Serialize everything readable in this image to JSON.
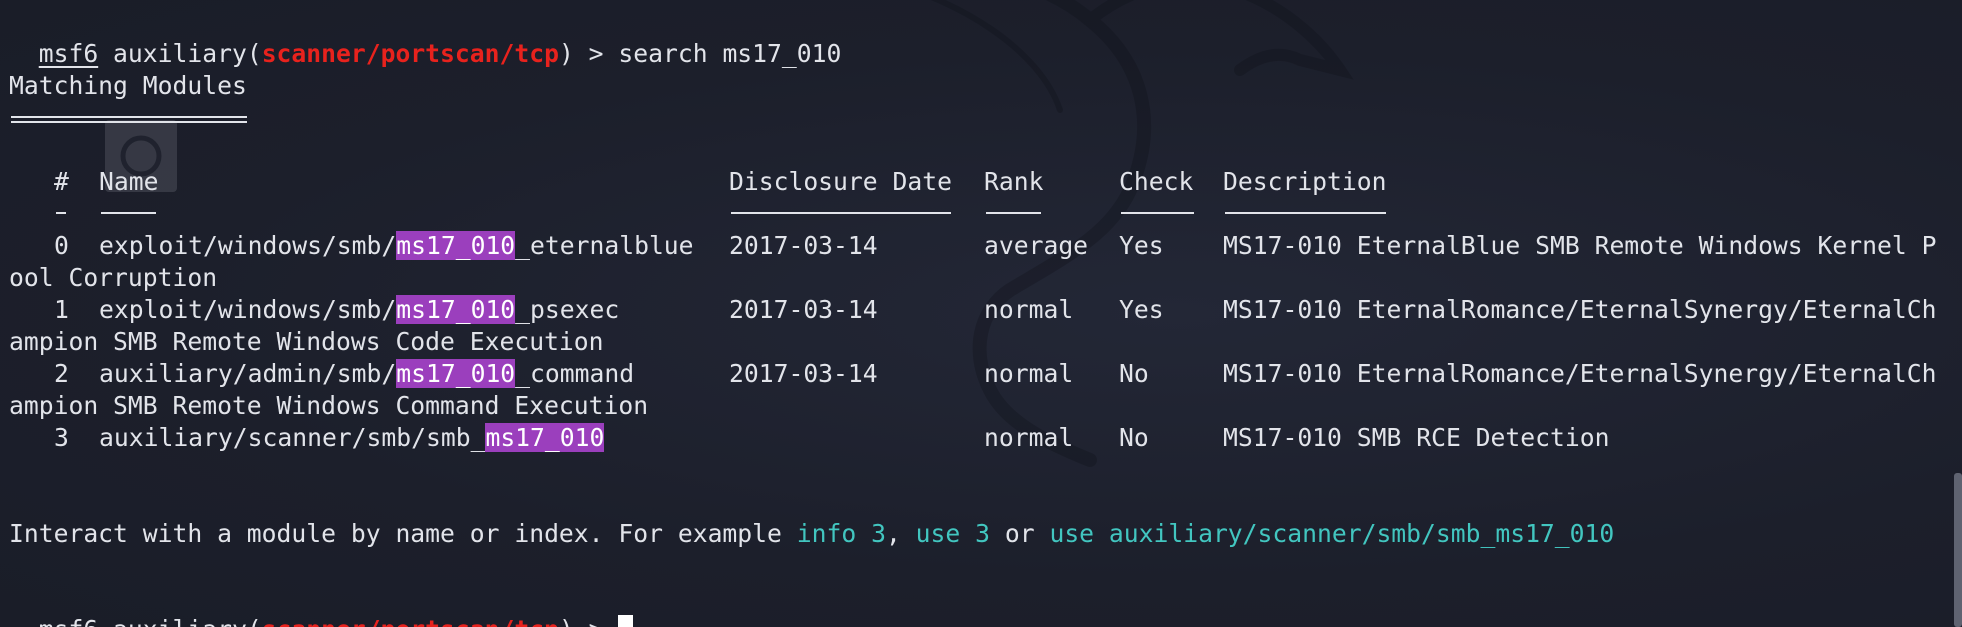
{
  "prompt": {
    "user": "msf6",
    "module_prefix": " auxiliary(",
    "module_path": "scanner/portscan/tcp",
    "suffix": ") > "
  },
  "command": "search ms17_010",
  "section_title": "Matching Modules",
  "columns": {
    "num": "#",
    "name": "Name",
    "date": "Disclosure Date",
    "rank": "Rank",
    "check": "Check",
    "description": "Description"
  },
  "search_term": "ms17_010",
  "rows": [
    {
      "num": "0",
      "name_pre": "exploit/windows/smb/",
      "name_match": "ms17_010",
      "name_post": "_eternalblue",
      "date": "2017-03-14",
      "rank": "average",
      "check": "Yes",
      "desc1": "MS17-010 EternalBlue SMB Remote Windows Kernel P",
      "desc2": "ool Corruption"
    },
    {
      "num": "1",
      "name_pre": "exploit/windows/smb/",
      "name_match": "ms17_010",
      "name_post": "_psexec",
      "date": "2017-03-14",
      "rank": "normal",
      "check": "Yes",
      "desc1": "MS17-010 EternalRomance/EternalSynergy/EternalCh",
      "desc2": "ampion SMB Remote Windows Code Execution"
    },
    {
      "num": "2",
      "name_pre": "auxiliary/admin/smb/",
      "name_match": "ms17_010",
      "name_post": "_command",
      "date": "2017-03-14",
      "rank": "normal",
      "check": "No",
      "desc1": "MS17-010 EternalRomance/EternalSynergy/EternalCh",
      "desc2": "ampion SMB Remote Windows Command Execution"
    },
    {
      "num": "3",
      "name_pre": "auxiliary/scanner/smb/smb_",
      "name_match": "ms17_010",
      "name_post": "",
      "date": "",
      "rank": "normal",
      "check": "No",
      "desc1": "MS17-010 SMB RCE Detection",
      "desc2": ""
    }
  ],
  "hint": {
    "text": "Interact with a module by name or index. For example ",
    "ex1": "info 3",
    "sep1": ", ",
    "ex2": "use 3",
    "sep2": " or ",
    "ex3": "use auxiliary/scanner/smb/smb_ms17_010"
  },
  "colors": {
    "background": "#1c1f2b",
    "text": "#e2e4ea",
    "module_path": "#e8221d",
    "highlight": "#9b3fbd",
    "example": "#42c6c0"
  },
  "icons": [
    "kali-dragon-watermark",
    "desktop-icon"
  ]
}
